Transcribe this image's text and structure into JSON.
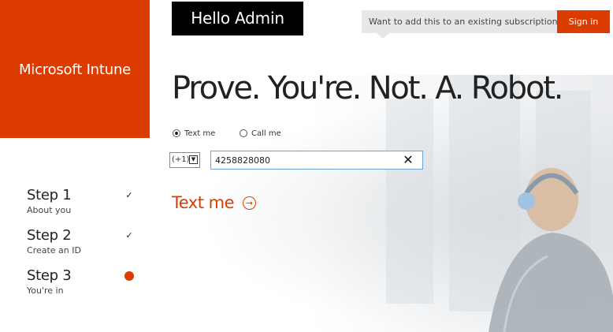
{
  "brand": {
    "title": "Microsoft Intune",
    "color": "#dc3c00"
  },
  "greeting": {
    "text": "Hello Admin"
  },
  "top_bar": {
    "subscription_prompt": "Want to add this to an existing subscription?",
    "sign_in_label": "Sign in"
  },
  "main": {
    "title": "Prove. You're. Not. A. Robot.",
    "options": [
      {
        "label": "Text me",
        "selected": true
      },
      {
        "label": "Call me",
        "selected": false
      }
    ],
    "country_code": "(+1)",
    "phone_number": "4258828080",
    "action_label": "Text me",
    "action_icon": "arrow-circle-right-icon"
  },
  "steps": [
    {
      "title": "Step 1",
      "subtitle": "About you",
      "status": "complete",
      "icon": "check-icon"
    },
    {
      "title": "Step 2",
      "subtitle": "Create an ID",
      "status": "complete",
      "icon": "check-icon"
    },
    {
      "title": "Step 3",
      "subtitle": "You're in",
      "status": "current",
      "icon": "current-dot-icon"
    }
  ]
}
